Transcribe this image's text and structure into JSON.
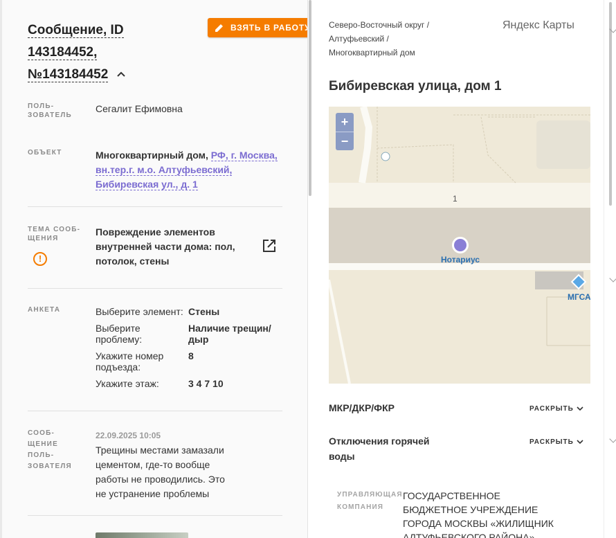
{
  "left": {
    "title_prefix": "Сообщение, ID",
    "title_id": "143184452,",
    "title_num": "№143184452",
    "take_button": "ВЗЯТЬ В РАБОТУ",
    "user": {
      "label": "ПОЛЬ-ЗОВАТЕЛЬ",
      "value": "Сегалит Ефимовна"
    },
    "object": {
      "label": "ОБЪЕКТ",
      "prefix": "Многоквартирный дом,",
      "link1": "РФ, г. Москва,",
      "link2": "вн.тер.г. м.о. Алтуфьевский,",
      "link3": "Бибиревская ул., д. 1"
    },
    "topic": {
      "label": "ТЕМА СООБ-ЩЕНИЯ",
      "line1": "Повреждение элементов",
      "line2": "внутренней части дома: пол,",
      "line3": "потолок, стены"
    },
    "survey": {
      "label": "АНКЕТА",
      "items": [
        {
          "k": "Выберите элемент:",
          "v": "Стены"
        },
        {
          "k": "Выберите проблему:",
          "v": "Наличие трещин/дыр"
        },
        {
          "k": "Укажите номер подъезда:",
          "v": "8"
        },
        {
          "k": "Укажите этаж:",
          "v": "3 4 7 10"
        }
      ]
    },
    "message": {
      "label": "СООБ-ЩЕНИЕ ПОЛЬ-ЗОВАТЕЛЯ",
      "date": "22.09.2025 10:05",
      "line1": "Трещины местами замазали",
      "line2": "цементом, где-то вообще",
      "line3": "работы не проводились. Это",
      "line4": "не устранение проблемы"
    }
  },
  "right": {
    "breadcrumb1": "Северо-Восточный округ /",
    "breadcrumb2": "Алтуфьевский /",
    "breadcrumb3": "Многоквартирный дом",
    "yandex": "Яндекс Карты",
    "address": "Бибиревская улица, дом 1",
    "map": {
      "zoom_in": "+",
      "zoom_out": "−",
      "house_number": "1",
      "poi1": "Нотариус",
      "poi2": "МГСА"
    },
    "sections": [
      {
        "title": "МКР/ДКР/ФКР",
        "action": "РАСКРЫТЬ"
      },
      {
        "title": "Отключения горячей воды",
        "action": "РАСКРЫТЬ"
      }
    ],
    "management": {
      "label": "УПРАВЛЯЮЩАЯ КОМПАНИЯ",
      "value": "ГОСУДАРСТВЕННОЕ БЮДЖЕТНОЕ УЧРЕЖДЕНИЕ ГОРОДА МОСКВЫ «ЖИЛИЩНИК АЛТУФЬЕВСКОГО РАЙОНА»"
    }
  },
  "colors": {
    "accent": "#f57c00",
    "link": "#7b6cd1",
    "map_bg": "#efe9d8",
    "poi": "#8a7fd6"
  }
}
